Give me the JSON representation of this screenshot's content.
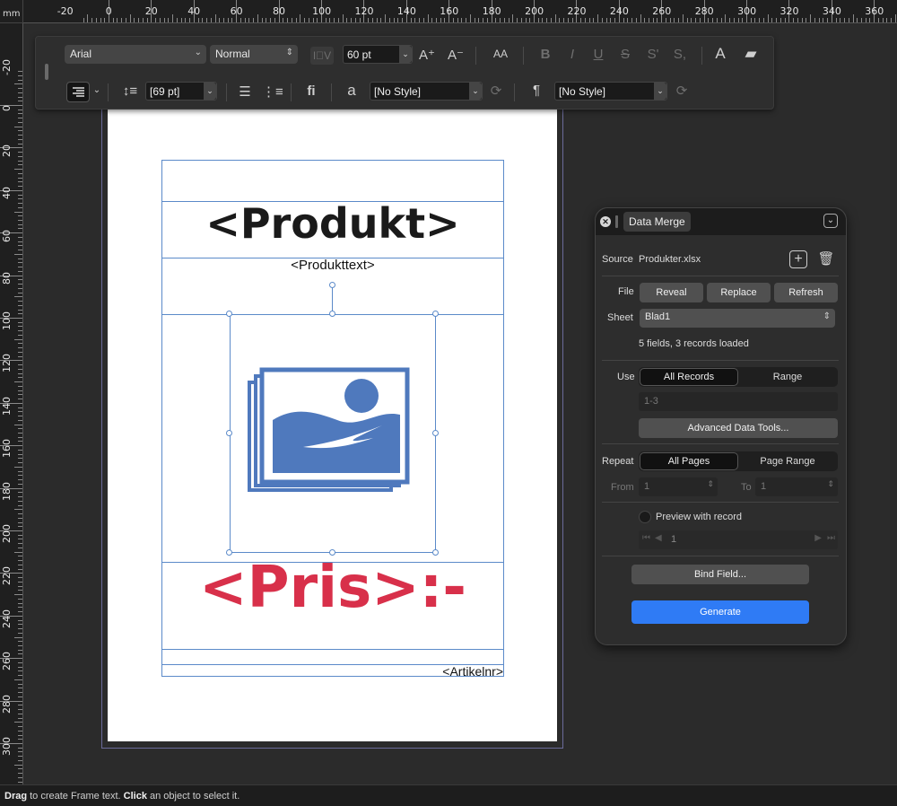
{
  "ruler": {
    "unit": "mm",
    "top_labels": [
      "-20",
      "0",
      "20",
      "40",
      "60",
      "80",
      "100",
      "120",
      "140",
      "160",
      "180",
      "200",
      "220",
      "240",
      "260",
      "280",
      "300",
      "320",
      "340",
      "360"
    ],
    "left_labels": [
      "-20",
      "0",
      "20",
      "40",
      "60",
      "80",
      "100",
      "120",
      "140",
      "160",
      "180",
      "200",
      "220",
      "240",
      "260",
      "280",
      "300"
    ]
  },
  "toolbar": {
    "font_family": "Arial",
    "font_style": "Normal",
    "font_size": "60 pt",
    "increase_size_icon": "A⁺",
    "decrease_size_icon": "A⁻",
    "all_caps_label": "AA",
    "bold_icon": "B",
    "italic_icon": "I",
    "underline_icon": "U",
    "strike_icon": "S",
    "superscript_icon": "S'",
    "subscript_icon": "S,",
    "leading": "[69 pt]",
    "ligature_label": "fi",
    "char_style_icon": "a",
    "char_style": "[No Style]",
    "para_style_icon": "¶",
    "para_style": "[No Style]"
  },
  "document": {
    "product_placeholder": "<Produkt>",
    "product_text_placeholder": "<Produkttext>",
    "price_placeholder": "<Pris>:-",
    "article_placeholder": "<Artikelnr>"
  },
  "data_merge": {
    "title": "Data Merge",
    "source_label": "Source",
    "source_file": "Produkter.xlsx",
    "file_label": "File",
    "reveal": "Reveal",
    "replace": "Replace",
    "refresh": "Refresh",
    "sheet_label": "Sheet",
    "sheet_value": "Blad1",
    "summary": "5 fields, 3 records loaded",
    "use_label": "Use",
    "use_all": "All Records",
    "use_range": "Range",
    "range_value": "1-3",
    "advanced": "Advanced Data Tools...",
    "repeat_label": "Repeat",
    "repeat_all": "All Pages",
    "repeat_range": "Page Range",
    "from_label": "From",
    "from_value": "1",
    "to_label": "To",
    "to_value": "1",
    "preview_label": "Preview with record",
    "preview_value": "1",
    "bind_field": "Bind Field...",
    "generate": "Generate"
  },
  "status": {
    "drag": "Drag",
    "drag_text": " to create Frame text. ",
    "click": "Click",
    "click_text": " an object to select it."
  }
}
